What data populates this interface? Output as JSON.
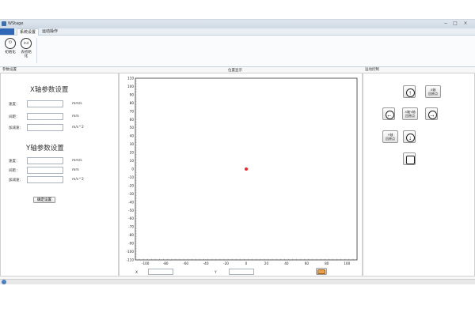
{
  "window": {
    "title": "WStage",
    "controls": {
      "minimize": "−",
      "maximize": "□",
      "close": "×"
    }
  },
  "ribbon": {
    "tabs": [
      {
        "label": "系统设置",
        "active": true
      },
      {
        "label": "运动操作",
        "active": false
      }
    ],
    "buttons": [
      {
        "label": "初始化",
        "icon": "power-icon",
        "glyph": "⏻"
      },
      {
        "label": "去初始\n化",
        "icon": "ind-icon",
        "glyph": "Ind"
      }
    ]
  },
  "left_panel": {
    "title": "参数设置",
    "x_group": {
      "title": "X轴参数设置",
      "fields": [
        {
          "label": "速度：",
          "value": "",
          "unit": "mm/s"
        },
        {
          "label": "间距：",
          "value": "",
          "unit": "mm"
        },
        {
          "label": "加减速：",
          "value": "",
          "unit": "m/s^2"
        }
      ]
    },
    "y_group": {
      "title": "Y轴参数设置",
      "fields": [
        {
          "label": "速度：",
          "value": "",
          "unit": "mm/s"
        },
        {
          "label": "间距：",
          "value": "",
          "unit": "mm"
        },
        {
          "label": "加减速：",
          "value": "",
          "unit": "m/s^2"
        }
      ]
    },
    "confirm_label": "确定设置"
  },
  "center_panel": {
    "title": "位置显示",
    "x_label": "X",
    "y_label": "Y",
    "x_value": "",
    "y_value": ""
  },
  "right_panel": {
    "title": "运动控制",
    "buttons": {
      "up": "↑",
      "left": "←",
      "right": "→",
      "down": "↓",
      "x_home": "X轴\n回原点",
      "xy_home": "X轴Y轴\n回原点",
      "y_home": "Y轴\n回原点",
      "stop_icon": "stop-hand-icon"
    }
  },
  "chart_data": {
    "type": "scatter",
    "xlim": [
      -110,
      110
    ],
    "ylim": [
      -110,
      110
    ],
    "x_ticks": [
      -100,
      -80,
      -60,
      -40,
      -20,
      0,
      20,
      40,
      60,
      80,
      100
    ],
    "y_ticks": [
      110,
      100,
      90,
      80,
      70,
      60,
      50,
      40,
      30,
      20,
      10,
      0,
      -10,
      -20,
      -30,
      -40,
      -50,
      -60,
      -70,
      -80,
      -90,
      -100,
      -110
    ],
    "grid": true,
    "points": [
      {
        "x": 0,
        "y": 0
      }
    ],
    "point_color": "#ff2020"
  }
}
